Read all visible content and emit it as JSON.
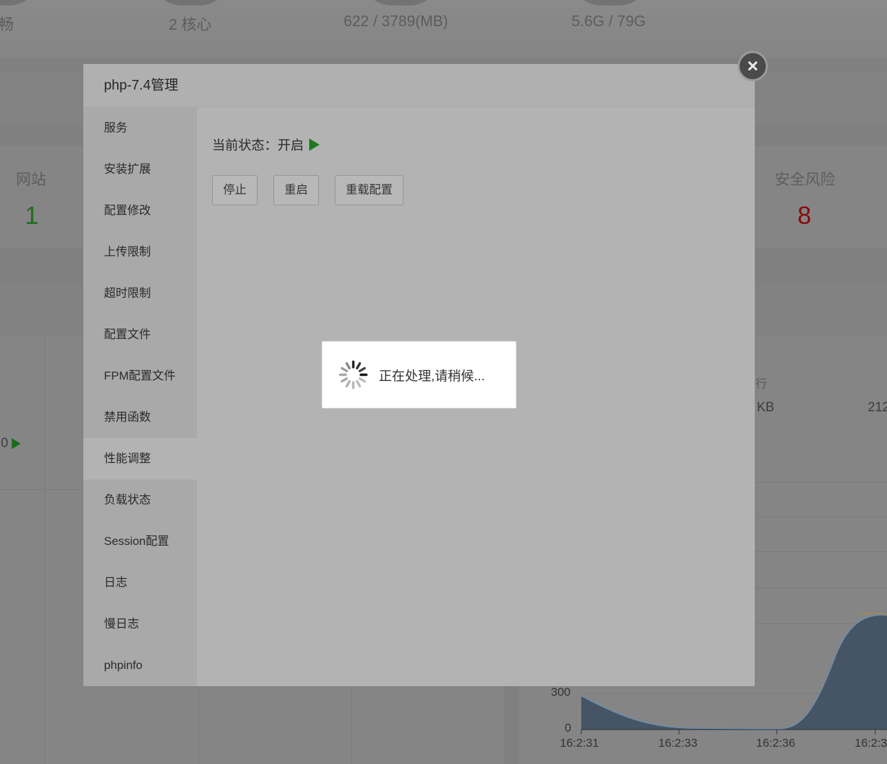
{
  "background": {
    "stats": [
      {
        "value": "畅"
      },
      {
        "value": "2 核心"
      },
      {
        "value": "622 / 3789(MB)"
      },
      {
        "value": "5.6G / 79G"
      }
    ],
    "overview": {
      "websites_label": "网站",
      "websites_value": "1",
      "security_label": "安全风险",
      "security_value": "8"
    },
    "fragments": {
      "left_value": ".0",
      "right_label": "行",
      "right_kb": "KB",
      "right_num": "212"
    },
    "chart_data": {
      "type": "area",
      "x": [
        "16:2:31",
        "16:2:33",
        "16:2:36",
        "16:2:3"
      ],
      "y_ticks": [
        "300",
        "0"
      ]
    }
  },
  "modal": {
    "title": "php-7.4管理",
    "close_icon": "close-icon",
    "sidebar": {
      "items": [
        {
          "label": "服务"
        },
        {
          "label": "安装扩展"
        },
        {
          "label": "配置修改"
        },
        {
          "label": "上传限制"
        },
        {
          "label": "超时限制"
        },
        {
          "label": "配置文件"
        },
        {
          "label": "FPM配置文件"
        },
        {
          "label": "禁用函数"
        },
        {
          "label": "性能调整"
        },
        {
          "label": "负载状态"
        },
        {
          "label": "Session配置"
        },
        {
          "label": "日志"
        },
        {
          "label": "慢日志"
        },
        {
          "label": "phpinfo"
        }
      ],
      "active_index": 8
    },
    "content": {
      "status_label": "当前状态：",
      "status_value": "开启",
      "buttons": {
        "stop": "停止",
        "restart": "重启",
        "reload": "重载配置"
      }
    }
  },
  "loading": {
    "text": "正在处理,请稍候..."
  },
  "colors": {
    "status_green": "#1d7a1d",
    "risk_red": "#8a0b0b",
    "site_green": "#1f6b1f"
  }
}
